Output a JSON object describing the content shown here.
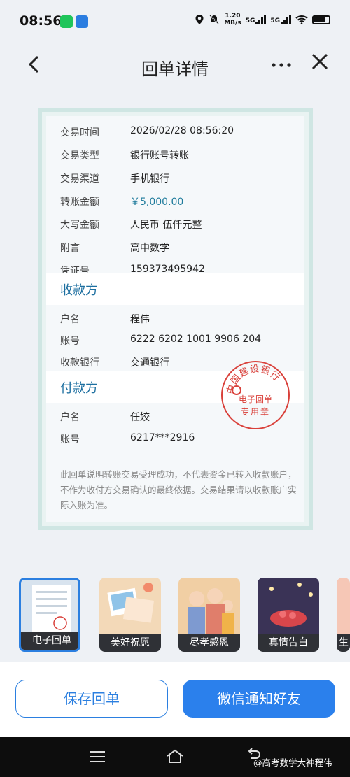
{
  "status_bar": {
    "time": "08:56",
    "speed_value": "1.20",
    "speed_unit": "MB/s",
    "network1": "5G",
    "network2": "5G"
  },
  "header": {
    "title": "回单详情",
    "back_icon": "chevron-left-icon",
    "more_icon": "more-horizontal-icon",
    "close_icon": "close-icon"
  },
  "receipt": {
    "rows": [
      {
        "label": "交易时间",
        "value": "2026/02/28 08:56:20"
      },
      {
        "label": "交易类型",
        "value": "银行账号转账"
      },
      {
        "label": "交易渠道",
        "value": "手机银行"
      },
      {
        "label": "转账金额",
        "value": "￥5,000.00"
      },
      {
        "label": "大写金额",
        "value": "人民币 伍仟元整"
      },
      {
        "label": "附言",
        "value": "高中数学"
      },
      {
        "label": "凭证号",
        "value": "159373495942"
      }
    ],
    "payee": {
      "section_title": "收款方",
      "rows": [
        {
          "label": "户名",
          "value": "程伟"
        },
        {
          "label": "账号",
          "value": "6222 6202 1001 9906 204"
        },
        {
          "label": "收款银行",
          "value": "交通银行"
        }
      ]
    },
    "payer": {
      "section_title": "付款方",
      "rows": [
        {
          "label": "户名",
          "value": "任姣"
        },
        {
          "label": "账号",
          "value": "6217***2916"
        }
      ]
    },
    "note": "此回单说明转账交易受理成功，不代表资金已转入收款账户，不作为收付方交易确认的最终依据。交易结果请以收款账户实际入账为准。",
    "stamp": {
      "arc_text": "中国建设银行",
      "line1": "电子回单",
      "line2": "专用章"
    }
  },
  "templates": [
    {
      "label": "电子回单"
    },
    {
      "label": "美好祝愿"
    },
    {
      "label": "尽孝感恩"
    },
    {
      "label": "真情告白"
    },
    {
      "label": "生"
    }
  ],
  "actions": {
    "save": "保存回单",
    "share": "微信通知好友"
  },
  "watermark": "@高考数学大神程伟",
  "colors": {
    "accent": "#2b80ec",
    "section_title": "#1d6fa0",
    "stamp": "#d9403a"
  }
}
